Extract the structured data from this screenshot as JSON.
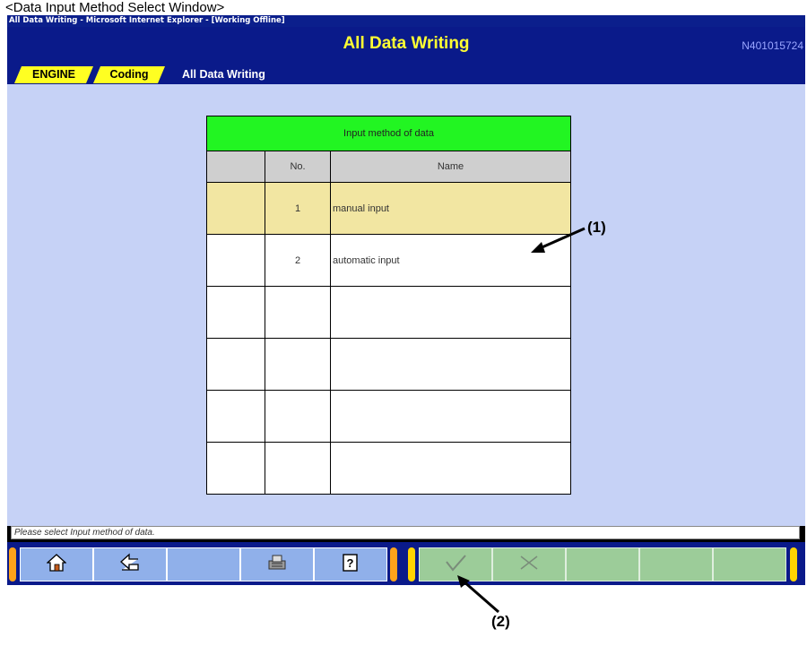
{
  "caption": "<Data Input Method Select Window>",
  "window": {
    "titlebar": "All Data Writing - Microsoft Internet Explorer - [Working Offline]",
    "header_title": "All Data Writing",
    "screen_id": "N401015724"
  },
  "breadcrumb": {
    "items": [
      {
        "label": "ENGINE"
      },
      {
        "label": "Coding"
      },
      {
        "label": "All Data Writing"
      }
    ]
  },
  "table": {
    "title": "Input method of data",
    "col_no": "No.",
    "col_name": "Name",
    "rows": [
      {
        "no": "1",
        "name": "manual input"
      },
      {
        "no": "2",
        "name": "automatic input"
      },
      {
        "no": "",
        "name": ""
      },
      {
        "no": "",
        "name": ""
      },
      {
        "no": "",
        "name": ""
      },
      {
        "no": "",
        "name": ""
      }
    ],
    "selected_row": 1
  },
  "status": {
    "message": "Please select Input method of data."
  },
  "toolbar": {
    "left_buttons": [
      "home-icon",
      "back-arrow-icon",
      "blank",
      "printer-icon",
      "help-icon"
    ],
    "right_buttons": [
      "check-icon",
      "cancel-icon",
      "blank",
      "blank",
      "blank"
    ]
  },
  "annotations": {
    "label_1": "(1)",
    "label_2": "(2)"
  },
  "colors": {
    "header_bg": "#0a1a8a",
    "title_text": "#ffff33",
    "content_bg": "#c6d2f6",
    "table_title_bg": "#22f522",
    "selected_row_bg": "#f2e6a2",
    "tab_yellow": "#ffff22"
  }
}
